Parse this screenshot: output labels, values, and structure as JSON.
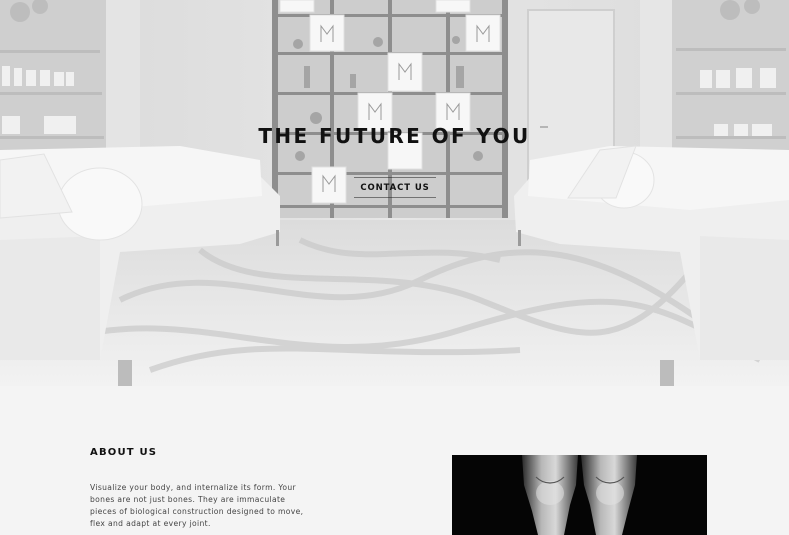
{
  "hero": {
    "title": "THE FUTURE OF YOU",
    "cta_label": "CONTACT US",
    "image": "clinic-lounge-grayscale"
  },
  "about": {
    "heading": "ABOUT US",
    "body": "Visualize your body, and internalize its form. Your bones are not just bones. They are immaculate pieces of biological construction designed to move, flex and adapt at every joint.",
    "image": "legs-photo-black-and-white"
  },
  "colors": {
    "page_bg": "#f4f4f4",
    "text": "#111111",
    "body_text": "#444444"
  }
}
